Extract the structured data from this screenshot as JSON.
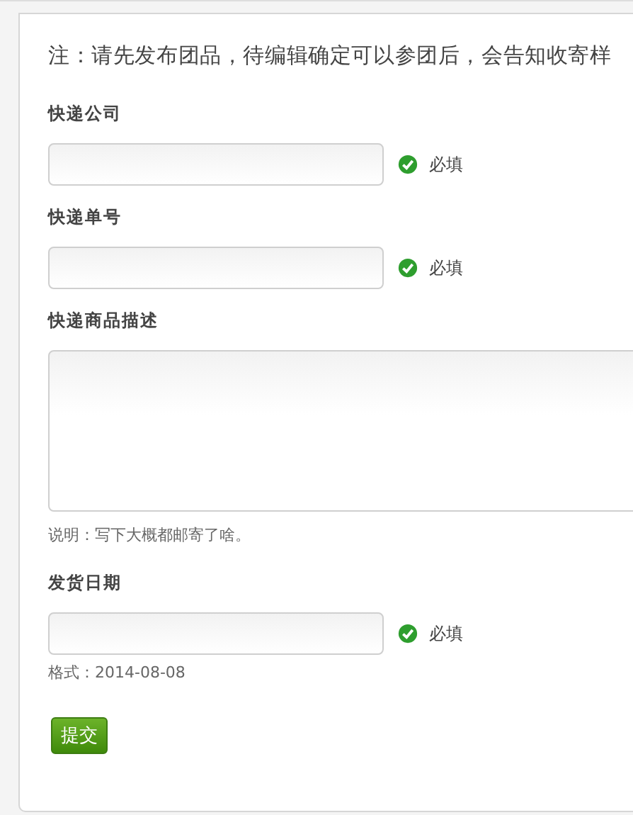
{
  "note": "注：请先发布团品，待编辑确定可以参团后，会告知收寄样",
  "fields": [
    {
      "label": "快递公司",
      "kind": "input",
      "required_text": "必填"
    },
    {
      "label": "快递单号",
      "kind": "input",
      "required_text": "必填"
    },
    {
      "label": "快递商品描述",
      "kind": "textarea",
      "hint": "说明：写下大概都邮寄了啥。"
    },
    {
      "label": "发货日期",
      "kind": "input",
      "required_text": "必填",
      "hint": "格式：2014-08-08"
    }
  ],
  "submit": "提交"
}
